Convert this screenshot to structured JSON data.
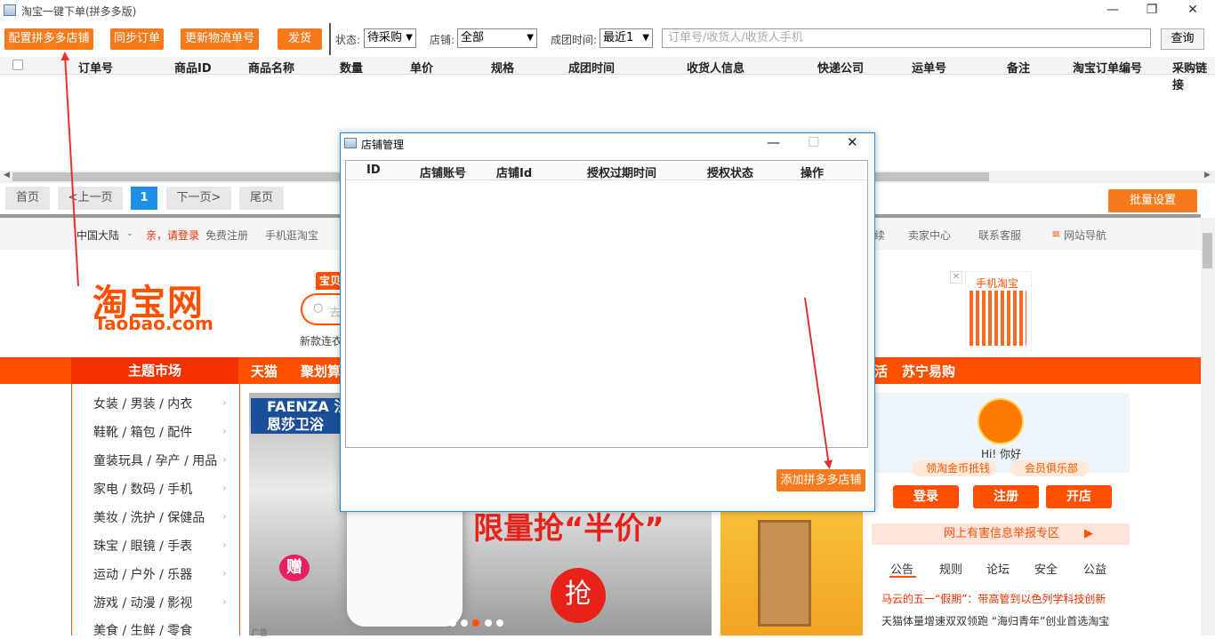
{
  "window": {
    "title": "淘宝一键下单(拼多多版)",
    "minimize": "—",
    "maximize": "❐",
    "close": "✕"
  },
  "toolbar": {
    "config_pdd_store": "配置拼多多店铺",
    "sync_orders": "同步订单",
    "update_logistics": "更新物流单号",
    "ship": "发货",
    "status_label": "状态:",
    "status_value": "待采购",
    "store_label": "店铺:",
    "store_value": "全部",
    "group_time_label": "成团时间:",
    "group_time_value": "最近1",
    "search_placeholder": "订单号/收货人/收货人手机",
    "query": "查询"
  },
  "table": {
    "columns": [
      "订单号",
      "商品ID",
      "商品名称",
      "数量",
      "单价",
      "规格",
      "成团时间",
      "收货人信息",
      "快递公司",
      "运单号",
      "备注",
      "淘宝订单编号",
      "采购链接"
    ]
  },
  "pagination": {
    "first": "首页",
    "prev": "<上一页",
    "current": "1",
    "next": "下一页>",
    "last": "尾页",
    "batch_settings": "批量设置"
  },
  "browser": {
    "topbar": {
      "region": "中国大陆",
      "login": "亲，请登录",
      "register": "免费注册",
      "mobile": "手机逛淘宝",
      "partial": "续",
      "seller": "卖家中心",
      "service": "联系客服",
      "sitenav": "网站导航"
    },
    "logo": {
      "main": "淘宝网",
      "sub": "Taobao.com"
    },
    "search_tab": "宝贝",
    "search_partial": "去",
    "hot_words": "新款连衣",
    "qr": {
      "label": "手机淘宝",
      "close": "✕"
    },
    "nav": {
      "theme": "主题市场",
      "items": [
        "天猫",
        "聚划算",
        "活",
        "苏宁易购"
      ]
    },
    "categories": [
      "女装 / 男装 / 内衣",
      "鞋靴 / 箱包 / 配件",
      "童装玩具 / 孕产 / 用品",
      "家电 / 数码 / 手机",
      "美妆 / 洗护 / 保健品",
      "珠宝 / 眼镜 / 手表",
      "运动 / 户外 / 乐器",
      "游戏 / 动漫 / 影视",
      "美食 / 生鲜 / 零食"
    ],
    "banner": {
      "brand": "FAENZA 法恩莎卫浴",
      "headline": "限量抢“半价”",
      "grab": "抢",
      "gift": "赠",
      "ad_tag": "广告"
    },
    "user": {
      "hi": "Hi! 你好",
      "coins": "领淘金币抵钱",
      "club": "会员俱乐部",
      "login": "登录",
      "register": "注册",
      "open_store": "开店",
      "report": "网上有害信息举报专区"
    },
    "news_tabs": [
      "公告",
      "规则",
      "论坛",
      "安全",
      "公益"
    ],
    "news": [
      "马云的五一“假期”：带高管到以色列学科技创新",
      "天猫体量增速双双领跑 “海归青年”创业首选淘宝"
    ]
  },
  "dialog": {
    "title": "店铺管理",
    "columns": [
      "ID",
      "店铺账号",
      "店铺Id",
      "授权过期时间",
      "授权状态",
      "操作"
    ],
    "add_button": "添加拼多多店铺"
  },
  "colors": {
    "accent": "#f77a1c",
    "taobao": "#ff5000",
    "page_active": "#1e90e8",
    "arrow": "#e8312f"
  }
}
